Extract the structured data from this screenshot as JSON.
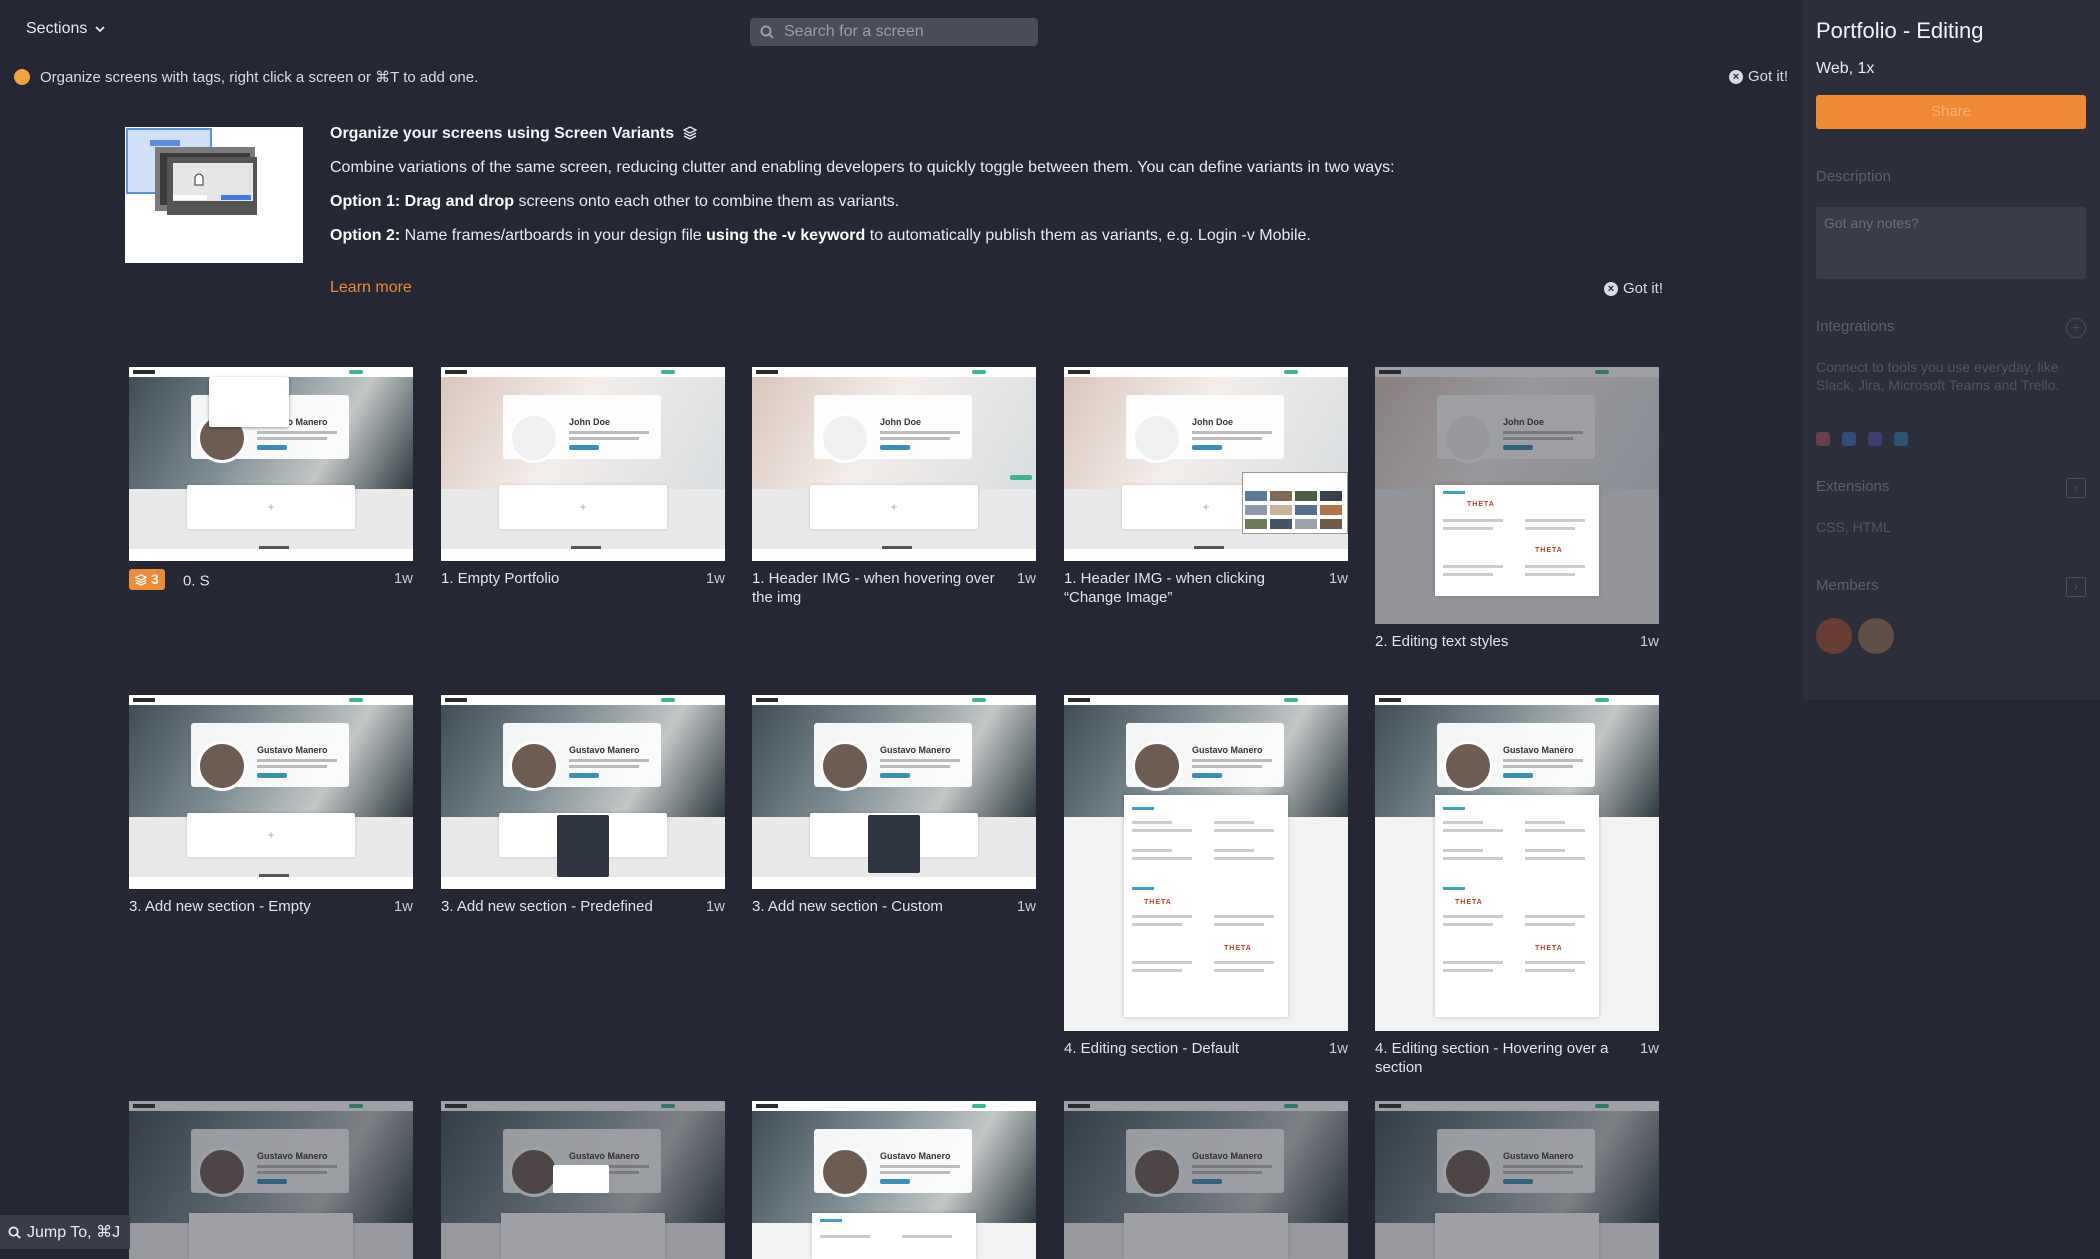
{
  "topbar": {
    "sections_label": "Sections",
    "search_placeholder": "Search for a screen"
  },
  "tip": {
    "text": "Organize screens with tags, right click a screen or ⌘T to add one.",
    "got_it": "Got it!"
  },
  "variants_banner": {
    "title": "Organize your screens using Screen Variants",
    "line1": "Combine variations of the same screen, reducing clutter and enabling developers to quickly toggle between them. You can define variants in two ways:",
    "option1_label": "Option 1:",
    "option1_bold": "Drag and drop",
    "option1_rest": "screens onto each other to combine them as variants.",
    "option2_label": "Option 2:",
    "option2_pre": "Name frames/artboards in your design file",
    "option2_bold": "using the -v keyword",
    "option2_rest": "to automatically publish them as variants, e.g. Login -v Mobile.",
    "learn_more": "Learn more",
    "got_it": "Got it!"
  },
  "screens": [
    {
      "name": "0. S",
      "age": "1w",
      "variants": "3"
    },
    {
      "name": "1. Empty Portfolio",
      "age": "1w"
    },
    {
      "name": "1. Header IMG - when hovering over the img",
      "age": "1w"
    },
    {
      "name": "1. Header IMG - when clicking “Change Image”",
      "age": "1w"
    },
    {
      "name": "2. Editing text styles",
      "age": "1w"
    },
    {
      "name": "3. Add new section - Empty",
      "age": "1w"
    },
    {
      "name": "3. Add new section - Predefined",
      "age": "1w"
    },
    {
      "name": "3. Add new section - Custom",
      "age": "1w"
    },
    {
      "name": "4. Editing section - Default",
      "age": "1w"
    },
    {
      "name": "4. Editing section - Hovering over a section",
      "age": "1w"
    }
  ],
  "thumb_text": {
    "person_name": "Gustavo Manero",
    "empty_name": "John Doe",
    "theta": "THETA"
  },
  "sidebar": {
    "title": "Portfolio - Editing",
    "platform": "Web, 1x",
    "share": "Share",
    "description_label": "Description",
    "description_placeholder": "Got any notes?",
    "integrations_label": "Integrations",
    "integrations_text": "Connect to tools you use everyday, like Slack, Jira, Microsoft Teams and Trello.",
    "extensions_label": "Extensions",
    "extensions_text": "CSS, HTML",
    "members_label": "Members"
  },
  "jump": {
    "label": "Jump To, ⌘J"
  },
  "colors": {
    "accent": "#f08a32",
    "background": "#252734",
    "sidebar": "#2c2e3b"
  }
}
